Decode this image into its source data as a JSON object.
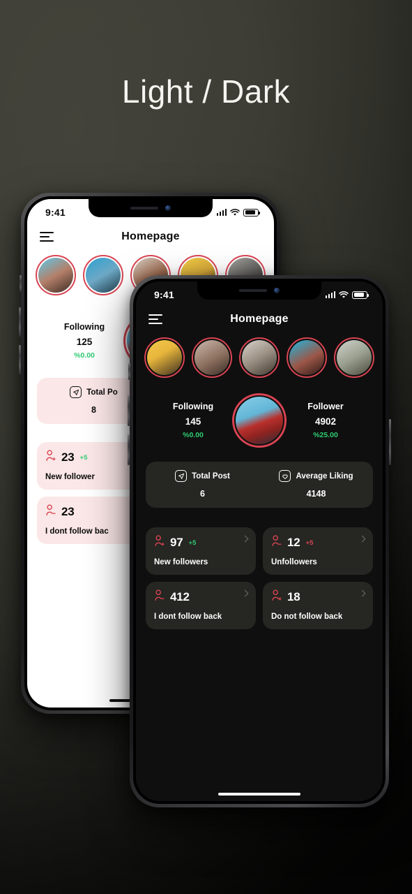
{
  "page": {
    "title": "Light / Dark",
    "background_color": "#3a3a33",
    "accent_color": "#d94452",
    "positive_color": "#2ecc71"
  },
  "light_phone": {
    "theme": "light",
    "status_bar": {
      "time": "9:41",
      "signal_icon": "signal-bars-icon",
      "wifi_icon": "wifi-icon",
      "battery_icon": "battery-icon"
    },
    "appbar": {
      "menu_icon": "hamburger-menu-icon",
      "title": "Homepage"
    },
    "stories": [
      {
        "id": "story-1"
      },
      {
        "id": "story-2"
      },
      {
        "id": "story-3"
      },
      {
        "id": "story-4"
      },
      {
        "id": "story-5"
      }
    ],
    "following": {
      "label": "Following",
      "value": "125",
      "percent": "%0.00"
    },
    "summary_card": {
      "total_post": {
        "icon": "send-icon",
        "label": "Total Po",
        "value": "8"
      }
    },
    "stat_cards": [
      {
        "icon": "user-plus-icon",
        "value": "23",
        "delta": "+5",
        "delta_color": "#2ecc71",
        "label": "New follower"
      },
      {
        "icon": "user-minus-icon",
        "value": "23",
        "delta": "",
        "delta_color": "#d94452",
        "label": "I dont follow bac"
      }
    ]
  },
  "dark_phone": {
    "theme": "dark",
    "status_bar": {
      "time": "9:41",
      "signal_icon": "signal-bars-icon",
      "wifi_icon": "wifi-icon",
      "battery_icon": "battery-icon"
    },
    "appbar": {
      "menu_icon": "hamburger-menu-icon",
      "title": "Homepage"
    },
    "stories": [
      {
        "id": "story-1"
      },
      {
        "id": "story-2"
      },
      {
        "id": "story-3"
      },
      {
        "id": "story-4"
      },
      {
        "id": "story-5"
      }
    ],
    "following": {
      "label": "Following",
      "value": "145",
      "percent": "%0.00"
    },
    "follower": {
      "label": "Follower",
      "value": "4902",
      "percent": "%25.00"
    },
    "profile_avatar": "profile-avatar",
    "summary_card": {
      "total_post": {
        "icon": "send-icon",
        "label": "Total Post",
        "value": "6"
      },
      "average_liking": {
        "icon": "heart-icon",
        "label": "Average Liking",
        "value": "4148"
      }
    },
    "stat_cards": [
      {
        "icon": "user-plus-icon",
        "value": "97",
        "delta": "+5",
        "delta_color": "#2ecc71",
        "label": "New followers"
      },
      {
        "icon": "user-minus-icon",
        "value": "12",
        "delta": "+5",
        "delta_color": "#d94452",
        "label": "Unfollowers"
      },
      {
        "icon": "user-minus-icon",
        "value": "412",
        "delta": "",
        "delta_color": "#d94452",
        "label": "I dont follow back"
      },
      {
        "icon": "user-x-icon",
        "value": "18",
        "delta": "",
        "delta_color": "#d94452",
        "label": "Do not follow back"
      }
    ]
  }
}
